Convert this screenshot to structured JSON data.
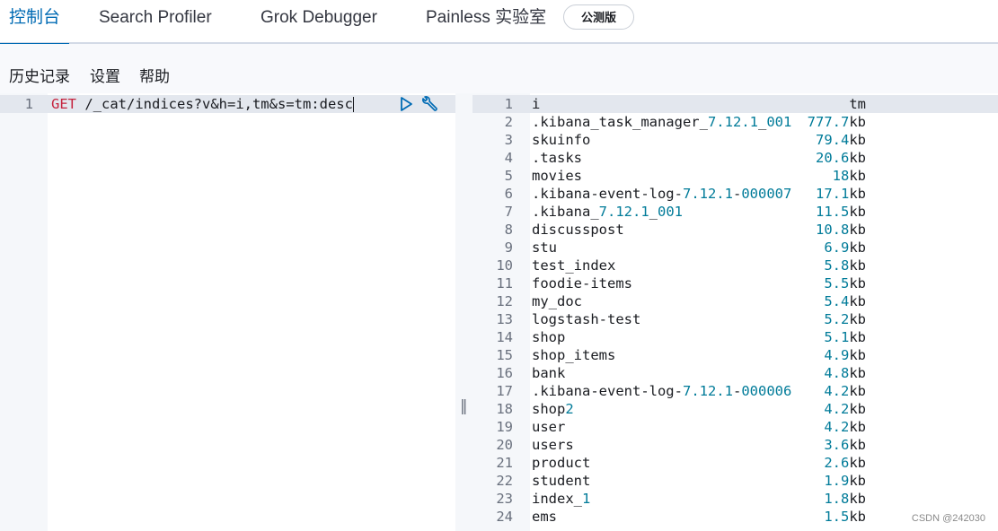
{
  "tabs": [
    {
      "label": "控制台",
      "active": true
    },
    {
      "label": "Search Profiler",
      "active": false
    },
    {
      "label": "Grok Debugger",
      "active": false
    },
    {
      "label": "Painless 实验室",
      "active": false
    }
  ],
  "beta_badge": "公测版",
  "menu": [
    "历史记录",
    "设置",
    "帮助"
  ],
  "request": {
    "line_number": "1",
    "method": "GET",
    "path": "/_cat/indices?v&h=i,tm&s=tm:desc",
    "play_icon": "play-icon",
    "wrench_icon": "wrench-icon"
  },
  "response": {
    "header": [
      "i",
      "tm"
    ],
    "rows": [
      [
        ".kibana_task_manager_7.12.1_001",
        "777.7kb"
      ],
      [
        "skuinfo",
        "79.4kb"
      ],
      [
        ".tasks",
        "20.6kb"
      ],
      [
        "movies",
        "18kb"
      ],
      [
        ".kibana-event-log-7.12.1-000007",
        "17.1kb"
      ],
      [
        ".kibana_7.12.1_001",
        "11.5kb"
      ],
      [
        "discusspost",
        "10.8kb"
      ],
      [
        "stu",
        "6.9kb"
      ],
      [
        "test_index",
        "5.8kb"
      ],
      [
        "foodie-items",
        "5.5kb"
      ],
      [
        "my_doc",
        "5.4kb"
      ],
      [
        "logstash-test",
        "5.2kb"
      ],
      [
        "shop",
        "5.1kb"
      ],
      [
        "shop_items",
        "4.9kb"
      ],
      [
        "bank",
        "4.8kb"
      ],
      [
        ".kibana-event-log-7.12.1-000006",
        "4.2kb"
      ],
      [
        "shop2",
        "4.2kb"
      ],
      [
        "user",
        "4.2kb"
      ],
      [
        "users",
        "3.6kb"
      ],
      [
        "product",
        "2.6kb"
      ],
      [
        "student",
        "1.9kb"
      ],
      [
        "index_1",
        "1.8kb"
      ],
      [
        "ems",
        "1.5kb"
      ]
    ]
  },
  "watermark": "CSDN @242030",
  "colors": {
    "accent": "#006bb4",
    "keyword": "#c5223d",
    "number": "#007b99"
  }
}
